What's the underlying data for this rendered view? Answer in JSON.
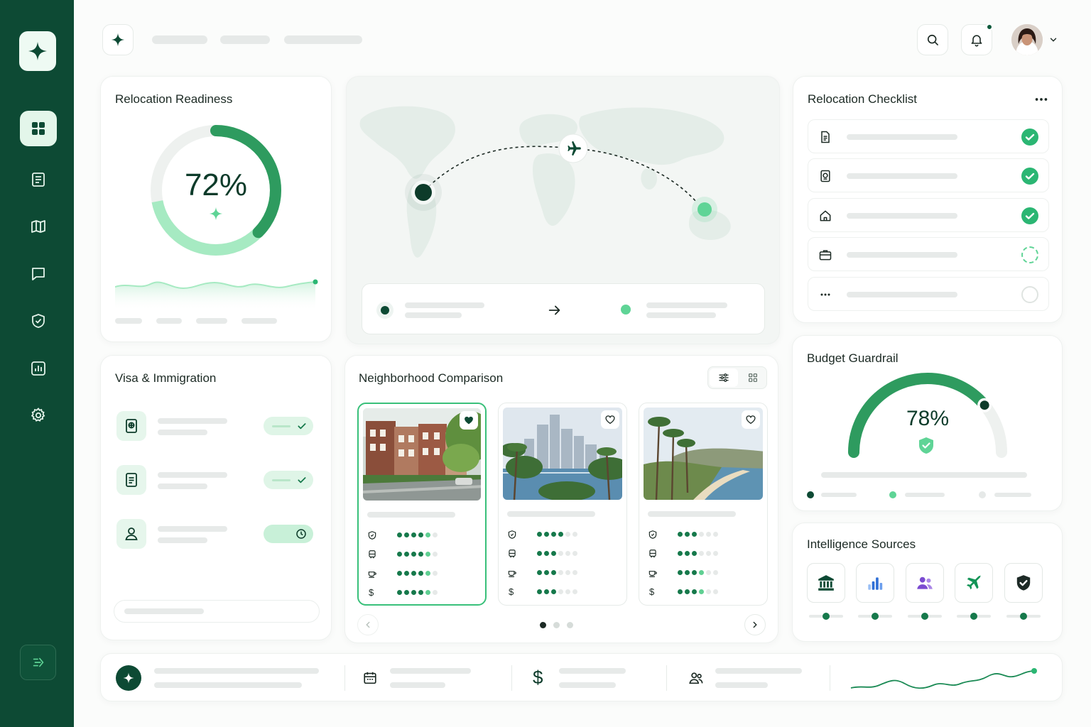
{
  "cards": {
    "readiness": {
      "title": "Relocation Readiness",
      "percent_label": "72%",
      "progress": 0.72
    },
    "checklist": {
      "title": "Relocation Checklist",
      "more_icon": "more-horizontal-icon",
      "items": [
        {
          "icon": "document-icon",
          "state": "done"
        },
        {
          "icon": "passport-icon",
          "state": "done"
        },
        {
          "icon": "home-icon",
          "state": "done"
        },
        {
          "icon": "briefcase-icon",
          "state": "in-progress"
        },
        {
          "icon": "more-horizontal-icon",
          "state": "pending"
        }
      ]
    },
    "visa": {
      "title": "Visa & Immigration",
      "items": [
        {
          "icon": "passport-icon",
          "status": "approved"
        },
        {
          "icon": "document-icon",
          "status": "approved"
        },
        {
          "icon": "user-icon",
          "status": "pending"
        }
      ]
    },
    "neighborhood": {
      "title": "Neighborhood Comparison",
      "view_icons": [
        "sliders-icon",
        "grid-icon"
      ],
      "metric_icons": [
        "shield-icon",
        "transit-icon",
        "coffee-icon",
        "dollar-icon"
      ],
      "dollar_symbol": "$",
      "options": [
        {
          "photo": "brownstone-street",
          "favorited": true,
          "selected": true,
          "scores": [
            4.7,
            4.6,
            4.7,
            4.7
          ]
        },
        {
          "photo": "city-skyline-bay",
          "favorited": false,
          "selected": false,
          "scores": [
            4,
            3,
            3,
            3
          ]
        },
        {
          "photo": "coastal-palms",
          "favorited": false,
          "selected": false,
          "scores": [
            3,
            3,
            3.5,
            3.5
          ]
        }
      ],
      "page_count": 3,
      "active_page": 0
    },
    "budget": {
      "title": "Budget Guardrail",
      "percent_label": "78%",
      "progress": 0.78
    },
    "sources": {
      "title": "Intelligence Sources",
      "items": [
        {
          "icon": "bank-icon",
          "color": "#0d4a34"
        },
        {
          "icon": "bar-chart-icon",
          "color": "#2f6fd6"
        },
        {
          "icon": "users-icon",
          "color": "#7b4bd1"
        },
        {
          "icon": "plane-icon",
          "color": "#139457"
        },
        {
          "icon": "shield-check-icon",
          "color": "#1d2a26"
        }
      ]
    }
  },
  "bottom_bar": {
    "dollar_symbol": "$"
  },
  "colors": {
    "brand": "#0d4a34",
    "accent": "#2bb673",
    "light_accent": "#5fd496"
  }
}
